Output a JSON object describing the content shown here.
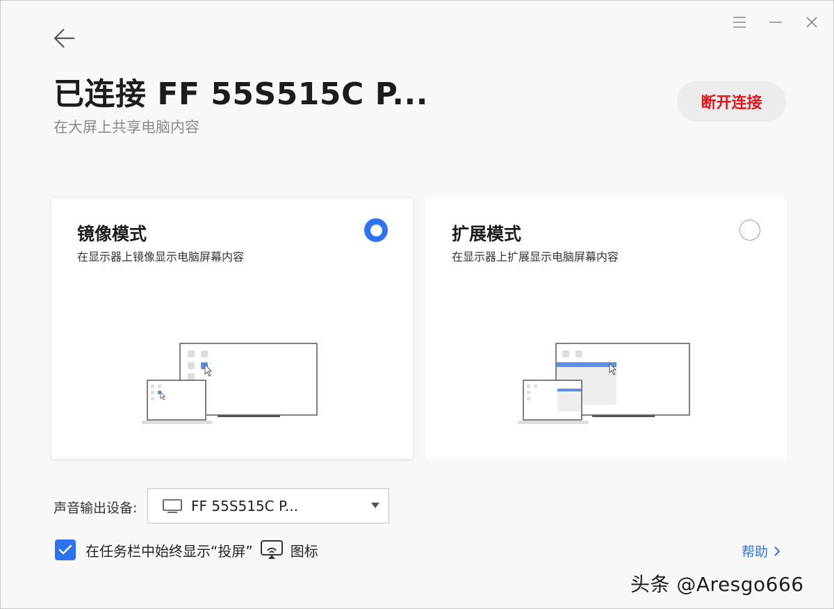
{
  "header": {
    "title": "已连接 FF 55S515C P...",
    "subtitle": "在大屏上共享电脑内容",
    "disconnect_label": "断开连接"
  },
  "modes": [
    {
      "title": "镜像模式",
      "desc": "在显示器上镜像显示电脑屏幕内容",
      "selected": true
    },
    {
      "title": "扩展模式",
      "desc": "在显示器上扩展显示电脑屏幕内容",
      "selected": false
    }
  ],
  "audio": {
    "label": "声音输出设备:",
    "selected_device": "FF 55S515C P..."
  },
  "taskbar_option": {
    "checked": true,
    "text_before": "在任务栏中始终显示“投屏”",
    "text_after": "图标"
  },
  "help_label": "帮助",
  "watermark": "头条 @Aresgo666",
  "colors": {
    "accent": "#2d72f0",
    "danger": "#e0161a"
  },
  "icons": [
    "back-arrow-icon",
    "menu-icon",
    "minimize-icon",
    "close-icon",
    "monitor-icon",
    "dropdown-arrow-icon",
    "checkmark-icon",
    "cast-screen-icon",
    "chevron-right-icon"
  ]
}
